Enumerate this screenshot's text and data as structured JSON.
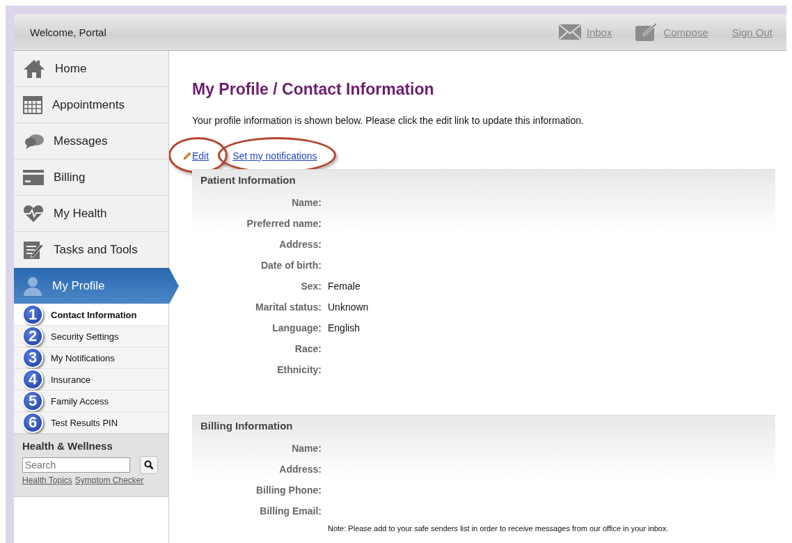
{
  "header": {
    "welcome": "Welcome, Portal",
    "links": [
      {
        "label": "Inbox"
      },
      {
        "label": "Compose"
      },
      {
        "label": "Sign Out"
      }
    ]
  },
  "sidebar": {
    "items": [
      {
        "label": "Home",
        "selected": false
      },
      {
        "label": "Appointments",
        "selected": false
      },
      {
        "label": "Messages",
        "selected": false
      },
      {
        "label": "Billing",
        "selected": false
      },
      {
        "label": "My Health",
        "selected": false
      },
      {
        "label": "Tasks and Tools",
        "selected": false
      },
      {
        "label": "My Profile",
        "selected": true
      }
    ],
    "subitems": [
      {
        "number": "1",
        "label": "Contact Information",
        "selected": true
      },
      {
        "number": "2",
        "label": "Security Settings",
        "selected": false
      },
      {
        "number": "3",
        "label": "My Notifications",
        "selected": false
      },
      {
        "number": "4",
        "label": "Insurance",
        "selected": false
      },
      {
        "number": "5",
        "label": "Family Access",
        "selected": false
      },
      {
        "number": "6",
        "label": "Test Results PIN",
        "selected": false
      }
    ],
    "health": {
      "title": "Health & Wellness",
      "search": {
        "placeholder": "Search"
      },
      "links": [
        "Health Topics",
        "Symptom Checker"
      ]
    }
  },
  "content": {
    "title": "My Profile / Contact Information",
    "intro": "Your profile information is shown below. Please click the edit link to update this information.",
    "actions": [
      {
        "label": "Edit",
        "kind": "edit",
        "circled": true
      },
      {
        "label": "Set my notifications",
        "kind": "link",
        "circled": true
      }
    ],
    "sections": [
      {
        "title": "Patient Information",
        "fields": [
          {
            "label": "Name:"
          },
          {
            "label": "Preferred name:"
          },
          {
            "label": "Address:"
          },
          {
            "label": "Date of birth:"
          },
          {
            "label": "Sex:",
            "value": "Female"
          },
          {
            "label": "Marital status:",
            "value": "Unknown"
          },
          {
            "label": "Language:",
            "value": "English"
          },
          {
            "label": "Race:"
          },
          {
            "label": "Ethnicity:"
          }
        ]
      },
      {
        "title": "Billing Information",
        "fields": [
          {
            "label": "Name:"
          },
          {
            "label": "Address:"
          },
          {
            "label": "Billing Phone:"
          },
          {
            "label": "Billing Email:"
          }
        ],
        "note": "Note: Please add to your safe senders list in order to receive messages from our office in your inbox."
      }
    ]
  }
}
